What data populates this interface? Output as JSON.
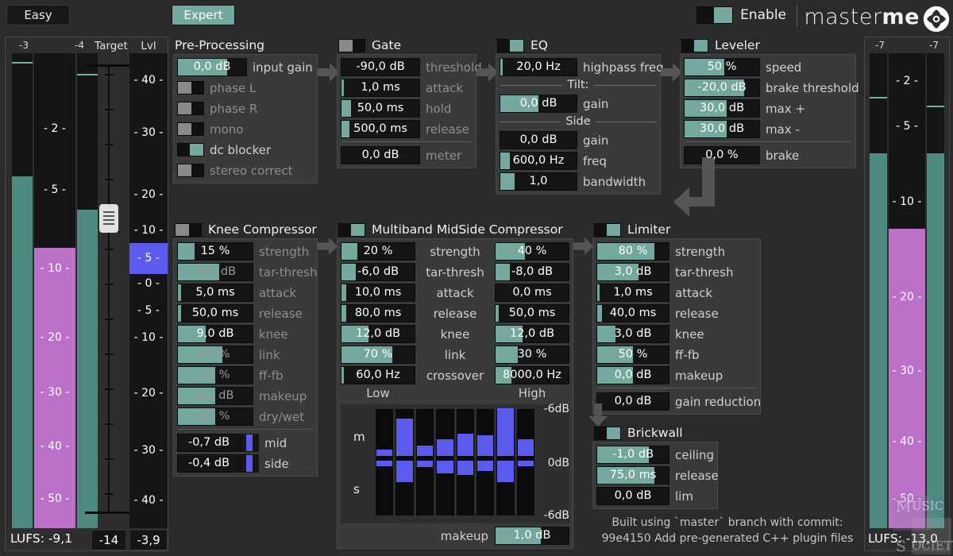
{
  "header": {
    "easy_label": "Easy",
    "expert_label": "Expert",
    "enable_label": "Enable",
    "enable_on": true,
    "brand_light": "master",
    "brand_bold": "me"
  },
  "left_meters": {
    "in_left_value": "-3",
    "in_right_value": "-4",
    "target_label": "Target",
    "lvl_gain_label": "Lvl Gain",
    "scale_ticks": [
      "- 2 -",
      "- 5 -",
      "- 10 -",
      "- 20 -",
      "- 30 -",
      "- 40 -",
      "- 50 -"
    ],
    "gain_ticks": [
      "- 40 -",
      "- 30 -",
      "- 20 -",
      "- 10 -",
      "- 5 -",
      "- 0 -",
      "- 5 -",
      "- 10 -",
      "- 20 -",
      "- 30 -",
      "- 40 -"
    ],
    "lufs_label": "LUFS: -9,1",
    "target_value": "-14",
    "lvl_gain_value": "-3,9"
  },
  "right_meters": {
    "out_left_value": "-7",
    "out_right_value": "-7",
    "scale_ticks": [
      "- 2 -",
      "- 5 -",
      "- 10 -",
      "- 20 -",
      "- 30 -",
      "- 40 -",
      "- 50 -"
    ],
    "lufs_label": "LUFS: -13,0"
  },
  "preprocessing": {
    "title": "Pre-Processing",
    "input_gain": {
      "value": "0,0 dB",
      "label": "input gain",
      "fill": 72
    },
    "toggles": [
      {
        "label": "phase L",
        "on": false
      },
      {
        "label": "phase R",
        "on": false
      },
      {
        "label": "mono",
        "on": false
      },
      {
        "label": "dc blocker",
        "on": true
      },
      {
        "label": "stereo correct",
        "on": false
      }
    ]
  },
  "gate": {
    "title": "Gate",
    "enabled": false,
    "params": [
      {
        "value": "-90,0 dB",
        "label": "threshold",
        "fill": 0
      },
      {
        "value": "1,0 ms",
        "label": "attack",
        "fill": 3
      },
      {
        "value": "50,0 ms",
        "label": "hold",
        "fill": 12
      },
      {
        "value": "500,0 ms",
        "label": "release",
        "fill": 10
      }
    ],
    "meter": {
      "value": "0,0 dB",
      "label": "meter"
    }
  },
  "eq": {
    "title": "EQ",
    "enabled": true,
    "highpass": {
      "value": "20,0 Hz",
      "label": "highpass freq",
      "fill": 3
    },
    "tilt_label": "Tilt:",
    "tilt_gain": {
      "value": "0,0 dB",
      "label": "gain",
      "fill": 50
    },
    "side_label": "Side",
    "side_gain": {
      "value": "0,0 dB",
      "label": "gain",
      "fill": 0
    },
    "side_freq": {
      "value": "600,0 Hz",
      "label": "freq",
      "fill": 13
    },
    "side_bandwidth": {
      "value": "1,0",
      "label": "bandwidth",
      "fill": 19
    }
  },
  "leveler": {
    "title": "Leveler",
    "enabled": true,
    "params": [
      {
        "value": "50 %",
        "label": "speed",
        "fill": 53
      },
      {
        "value": "-20,0 dB",
        "label": "brake threshold",
        "fill": 80
      },
      {
        "value": "30,0 dB",
        "label": "max +",
        "fill": 56
      },
      {
        "value": "30,0 dB",
        "label": "max -",
        "fill": 56
      }
    ],
    "brake": {
      "value": "0,0 %",
      "label": "brake"
    }
  },
  "knee_compressor": {
    "title": "Knee Compressor",
    "enabled": false,
    "params": [
      {
        "value": "15 %",
        "label": "strength",
        "fill": 22,
        "dim": false
      },
      {
        "value": "-6,0 dB",
        "label": "tar-thresh",
        "fill": 55,
        "dim": true
      },
      {
        "value": "5,0 ms",
        "label": "attack",
        "fill": 4,
        "dim": false
      },
      {
        "value": "50,0 ms",
        "label": "release",
        "fill": 4,
        "dim": false
      },
      {
        "value": "9,0 dB",
        "label": "knee",
        "fill": 37,
        "dim": false
      },
      {
        "value": "60 %",
        "label": "link",
        "fill": 60,
        "dim": true
      },
      {
        "value": "50 %",
        "label": "ff-fb",
        "fill": 50,
        "dim": true
      },
      {
        "value": "0,0 dB",
        "label": "makeup",
        "fill": 50,
        "dim": true
      },
      {
        "value": "50 %",
        "label": "dry/wet",
        "fill": 50,
        "dim": true
      }
    ],
    "meters": [
      {
        "value": "-0,7 dB",
        "label": "mid"
      },
      {
        "value": "-0,4 dB",
        "label": "side"
      }
    ]
  },
  "multiband": {
    "title": "Multiband MidSide Compressor",
    "enabled": true,
    "col_low_label": "Low",
    "col_high_label": "High",
    "rows": [
      {
        "label": "strength",
        "low": {
          "value": "20 %",
          "fill": 22
        },
        "high": {
          "value": "40 %",
          "fill": 40
        }
      },
      {
        "label": "tar-thresh",
        "low": {
          "value": "-6,0 dB",
          "fill": 20
        },
        "high": {
          "value": "-8,0 dB",
          "fill": 20
        }
      },
      {
        "label": "attack",
        "low": {
          "value": "10,0 ms",
          "fill": 7
        },
        "high": {
          "value": "0,0 ms",
          "fill": 0
        }
      },
      {
        "label": "release",
        "low": {
          "value": "80,0 ms",
          "fill": 7
        },
        "high": {
          "value": "50,0 ms",
          "fill": 4
        }
      },
      {
        "label": "knee",
        "low": {
          "value": "12,0 dB",
          "fill": 37
        },
        "high": {
          "value": "12,0 dB",
          "fill": 37
        }
      },
      {
        "label": "link",
        "low": {
          "value": "70 %",
          "fill": 70
        },
        "high": {
          "value": "30 %",
          "fill": 30
        }
      },
      {
        "label": "crossover",
        "low": {
          "value": "60,0 Hz",
          "fill": 3
        },
        "high": {
          "value": "8000,0 Hz",
          "fill": 22
        }
      }
    ],
    "viz": {
      "mid_label": "m",
      "side_label": "s",
      "top_label": "-6dB",
      "mid_axis_label": "0dB",
      "bottom_label": "-6dB",
      "bands_mid": [
        0.8,
        5.0,
        1.4,
        2.2,
        3.0,
        2.8,
        6.4,
        2.2
      ],
      "bands_side": [
        0.8,
        3.0,
        0.9,
        1.8,
        2.0,
        1.5,
        3.0,
        0.8
      ]
    },
    "makeup": {
      "label": "makeup",
      "value": "1,0 dB",
      "fill": 62
    }
  },
  "limiter": {
    "title": "Limiter",
    "enabled": true,
    "params": [
      {
        "value": "80 %",
        "label": "strength",
        "fill": 80
      },
      {
        "value": "3,0 dB",
        "label": "tar-thresh",
        "fill": 58
      },
      {
        "value": "1,0 ms",
        "label": "attack",
        "fill": 3
      },
      {
        "value": "40,0 ms",
        "label": "release",
        "fill": 7
      },
      {
        "value": "3,0 dB",
        "label": "knee",
        "fill": 25
      },
      {
        "value": "50 %",
        "label": "ff-fb",
        "fill": 50
      },
      {
        "value": "0,0 dB",
        "label": "makeup",
        "fill": 50
      }
    ],
    "gain_reduction": {
      "value": "0,0 dB",
      "label": "gain reduction"
    }
  },
  "brickwall": {
    "title": "Brickwall",
    "enabled": true,
    "params": [
      {
        "value": "-1,0 dB",
        "label": "ceiling",
        "fill": 72
      },
      {
        "value": "75,0 ms",
        "label": "release",
        "fill": 80
      }
    ],
    "lim": {
      "value": "0,0 dB",
      "label": "lim"
    }
  },
  "footer": {
    "line1": "Built using `master` branch with commit:",
    "line2": "99e4150 Add pre-generated C++ plugin files"
  },
  "colors": {
    "accent": "#74a79e",
    "meter_teal": "#4e8a82",
    "purple": "#bb71c7",
    "blue": "#5b5bf0",
    "panel_bg": "#3a3a3a",
    "slot_bg": "#151515"
  }
}
